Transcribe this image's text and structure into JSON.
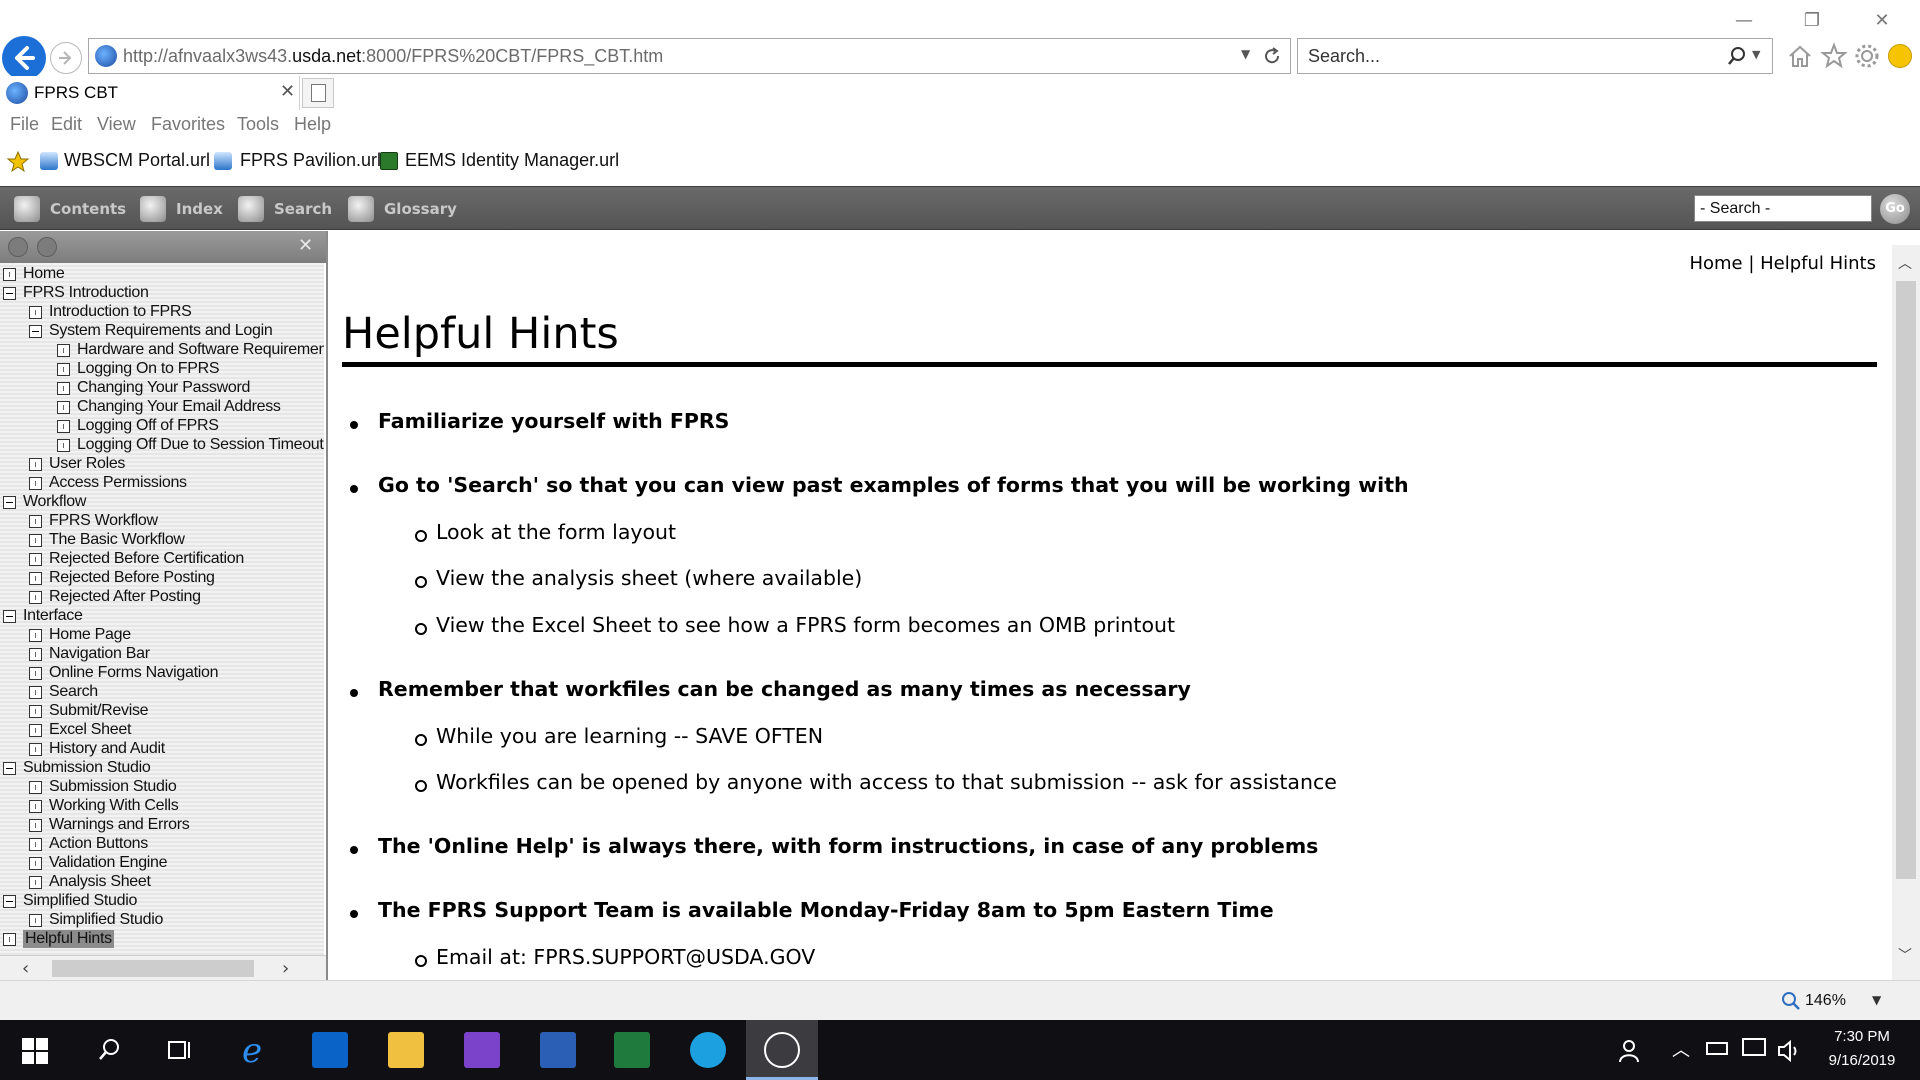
{
  "browser": {
    "address": {
      "prefix": "http://afnvaalx3ws43.",
      "host": "usda.net",
      "suffix": ":8000/FPRS%20CBT/FPRS_CBT.htm"
    },
    "search_placeholder": "Search...",
    "tab_title": "FPRS CBT",
    "menu": [
      "File",
      "Edit",
      "View",
      "Favorites",
      "Tools",
      "Help"
    ],
    "favorites": [
      "WBSCM Portal.url",
      "FPRS Pavilion.url",
      "EEMS Identity Manager.url"
    ],
    "zoom": "146%"
  },
  "help_toolbar": {
    "buttons": [
      "Contents",
      "Index",
      "Search",
      "Glossary"
    ],
    "search_value": "- Search -",
    "go_label": "Go"
  },
  "toc": {
    "items": [
      {
        "label": "Home",
        "level": 0,
        "type": "leaf"
      },
      {
        "label": "FPRS Introduction",
        "level": 0,
        "type": "open"
      },
      {
        "label": "Introduction to FPRS",
        "level": 1,
        "type": "leaf"
      },
      {
        "label": "System Requirements and Login",
        "level": 1,
        "type": "open"
      },
      {
        "label": "Hardware and Software Requirements",
        "level": 2,
        "type": "leaf"
      },
      {
        "label": "Logging On to FPRS",
        "level": 2,
        "type": "leaf"
      },
      {
        "label": "Changing Your Password",
        "level": 2,
        "type": "leaf"
      },
      {
        "label": "Changing Your Email Address",
        "level": 2,
        "type": "leaf"
      },
      {
        "label": "Logging Off of FPRS",
        "level": 2,
        "type": "leaf"
      },
      {
        "label": "Logging Off Due to Session Timeout",
        "level": 2,
        "type": "leaf"
      },
      {
        "label": "User Roles",
        "level": 1,
        "type": "leaf"
      },
      {
        "label": "Access Permissions",
        "level": 1,
        "type": "leaf"
      },
      {
        "label": "Workflow",
        "level": 0,
        "type": "open"
      },
      {
        "label": "FPRS Workflow",
        "level": 1,
        "type": "leaf"
      },
      {
        "label": "The Basic Workflow",
        "level": 1,
        "type": "leaf"
      },
      {
        "label": "Rejected Before Certification",
        "level": 1,
        "type": "leaf"
      },
      {
        "label": "Rejected Before Posting",
        "level": 1,
        "type": "leaf"
      },
      {
        "label": "Rejected After Posting",
        "level": 1,
        "type": "leaf"
      },
      {
        "label": "Interface",
        "level": 0,
        "type": "open"
      },
      {
        "label": "Home Page",
        "level": 1,
        "type": "leaf"
      },
      {
        "label": "Navigation Bar",
        "level": 1,
        "type": "leaf"
      },
      {
        "label": "Online Forms Navigation",
        "level": 1,
        "type": "leaf"
      },
      {
        "label": "Search",
        "level": 1,
        "type": "leaf"
      },
      {
        "label": "Submit/Revise",
        "level": 1,
        "type": "leaf"
      },
      {
        "label": "Excel Sheet",
        "level": 1,
        "type": "leaf"
      },
      {
        "label": "History and Audit",
        "level": 1,
        "type": "leaf"
      },
      {
        "label": "Submission Studio",
        "level": 0,
        "type": "open"
      },
      {
        "label": "Submission Studio",
        "level": 1,
        "type": "leaf"
      },
      {
        "label": "Working With Cells",
        "level": 1,
        "type": "leaf"
      },
      {
        "label": "Warnings and Errors",
        "level": 1,
        "type": "leaf"
      },
      {
        "label": "Action Buttons",
        "level": 1,
        "type": "leaf"
      },
      {
        "label": "Validation Engine",
        "level": 1,
        "type": "leaf"
      },
      {
        "label": "Analysis Sheet",
        "level": 1,
        "type": "leaf"
      },
      {
        "label": "Simplified Studio",
        "level": 0,
        "type": "open"
      },
      {
        "label": "Simplified Studio",
        "level": 1,
        "type": "leaf"
      },
      {
        "label": "Helpful Hints",
        "level": 0,
        "type": "leaf",
        "selected": true
      }
    ]
  },
  "content": {
    "breadcrumb": "Home | Helpful Hints",
    "title": "Helpful Hints",
    "bullets": [
      {
        "text": "Familiarize yourself with FPRS",
        "subs": []
      },
      {
        "text": "Go to 'Search' so that you can view past examples of forms that you will be working with",
        "subs": [
          "Look at the form layout",
          "View  the analysis sheet (where available)",
          "View  the Excel Sheet to see how a FPRS form becomes an OMB printout"
        ]
      },
      {
        "text": "Remember that workfiles can be changed as many times as necessary",
        "subs": [
          "While you are learning -- SAVE OFTEN",
          "Workfiles can be opened by anyone with access to that submission -- ask for assistance"
        ]
      },
      {
        "text": "The 'Online Help' is always there, with form instructions, in case of any problems",
        "subs": []
      },
      {
        "text": "The FPRS Support Team is available Monday-Friday 8am to 5pm Eastern Time",
        "subs": [
          "Email at: FPRS.SUPPORT@USDA.GOV"
        ]
      }
    ]
  },
  "taskbar": {
    "time": "7:30 PM",
    "date": "9/16/2019"
  },
  "colors": {
    "accent_blue": "#1b6fd6",
    "toolbar_gray": "#5f5f5f",
    "taskbar": "#101014"
  }
}
